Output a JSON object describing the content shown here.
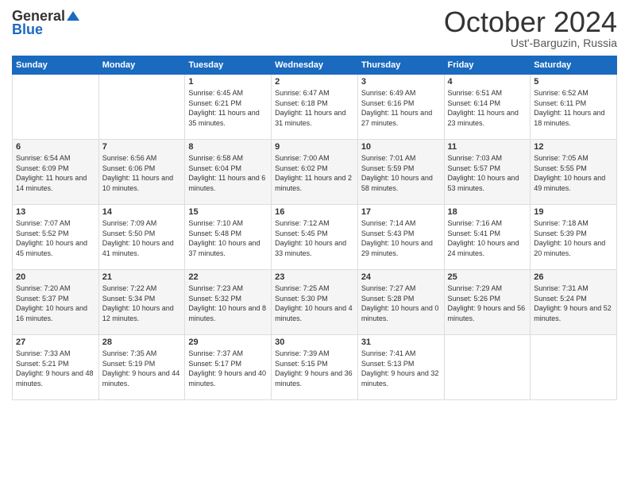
{
  "header": {
    "logo_general": "General",
    "logo_blue": "Blue",
    "month": "October 2024",
    "location": "Ust'-Barguzin, Russia"
  },
  "days_of_week": [
    "Sunday",
    "Monday",
    "Tuesday",
    "Wednesday",
    "Thursday",
    "Friday",
    "Saturday"
  ],
  "weeks": [
    [
      {
        "day": "",
        "info": ""
      },
      {
        "day": "",
        "info": ""
      },
      {
        "day": "1",
        "info": "Sunrise: 6:45 AM\nSunset: 6:21 PM\nDaylight: 11 hours and 35 minutes."
      },
      {
        "day": "2",
        "info": "Sunrise: 6:47 AM\nSunset: 6:18 PM\nDaylight: 11 hours and 31 minutes."
      },
      {
        "day": "3",
        "info": "Sunrise: 6:49 AM\nSunset: 6:16 PM\nDaylight: 11 hours and 27 minutes."
      },
      {
        "day": "4",
        "info": "Sunrise: 6:51 AM\nSunset: 6:14 PM\nDaylight: 11 hours and 23 minutes."
      },
      {
        "day": "5",
        "info": "Sunrise: 6:52 AM\nSunset: 6:11 PM\nDaylight: 11 hours and 18 minutes."
      }
    ],
    [
      {
        "day": "6",
        "info": "Sunrise: 6:54 AM\nSunset: 6:09 PM\nDaylight: 11 hours and 14 minutes."
      },
      {
        "day": "7",
        "info": "Sunrise: 6:56 AM\nSunset: 6:06 PM\nDaylight: 11 hours and 10 minutes."
      },
      {
        "day": "8",
        "info": "Sunrise: 6:58 AM\nSunset: 6:04 PM\nDaylight: 11 hours and 6 minutes."
      },
      {
        "day": "9",
        "info": "Sunrise: 7:00 AM\nSunset: 6:02 PM\nDaylight: 11 hours and 2 minutes."
      },
      {
        "day": "10",
        "info": "Sunrise: 7:01 AM\nSunset: 5:59 PM\nDaylight: 10 hours and 58 minutes."
      },
      {
        "day": "11",
        "info": "Sunrise: 7:03 AM\nSunset: 5:57 PM\nDaylight: 10 hours and 53 minutes."
      },
      {
        "day": "12",
        "info": "Sunrise: 7:05 AM\nSunset: 5:55 PM\nDaylight: 10 hours and 49 minutes."
      }
    ],
    [
      {
        "day": "13",
        "info": "Sunrise: 7:07 AM\nSunset: 5:52 PM\nDaylight: 10 hours and 45 minutes."
      },
      {
        "day": "14",
        "info": "Sunrise: 7:09 AM\nSunset: 5:50 PM\nDaylight: 10 hours and 41 minutes."
      },
      {
        "day": "15",
        "info": "Sunrise: 7:10 AM\nSunset: 5:48 PM\nDaylight: 10 hours and 37 minutes."
      },
      {
        "day": "16",
        "info": "Sunrise: 7:12 AM\nSunset: 5:45 PM\nDaylight: 10 hours and 33 minutes."
      },
      {
        "day": "17",
        "info": "Sunrise: 7:14 AM\nSunset: 5:43 PM\nDaylight: 10 hours and 29 minutes."
      },
      {
        "day": "18",
        "info": "Sunrise: 7:16 AM\nSunset: 5:41 PM\nDaylight: 10 hours and 24 minutes."
      },
      {
        "day": "19",
        "info": "Sunrise: 7:18 AM\nSunset: 5:39 PM\nDaylight: 10 hours and 20 minutes."
      }
    ],
    [
      {
        "day": "20",
        "info": "Sunrise: 7:20 AM\nSunset: 5:37 PM\nDaylight: 10 hours and 16 minutes."
      },
      {
        "day": "21",
        "info": "Sunrise: 7:22 AM\nSunset: 5:34 PM\nDaylight: 10 hours and 12 minutes."
      },
      {
        "day": "22",
        "info": "Sunrise: 7:23 AM\nSunset: 5:32 PM\nDaylight: 10 hours and 8 minutes."
      },
      {
        "day": "23",
        "info": "Sunrise: 7:25 AM\nSunset: 5:30 PM\nDaylight: 10 hours and 4 minutes."
      },
      {
        "day": "24",
        "info": "Sunrise: 7:27 AM\nSunset: 5:28 PM\nDaylight: 10 hours and 0 minutes."
      },
      {
        "day": "25",
        "info": "Sunrise: 7:29 AM\nSunset: 5:26 PM\nDaylight: 9 hours and 56 minutes."
      },
      {
        "day": "26",
        "info": "Sunrise: 7:31 AM\nSunset: 5:24 PM\nDaylight: 9 hours and 52 minutes."
      }
    ],
    [
      {
        "day": "27",
        "info": "Sunrise: 7:33 AM\nSunset: 5:21 PM\nDaylight: 9 hours and 48 minutes."
      },
      {
        "day": "28",
        "info": "Sunrise: 7:35 AM\nSunset: 5:19 PM\nDaylight: 9 hours and 44 minutes."
      },
      {
        "day": "29",
        "info": "Sunrise: 7:37 AM\nSunset: 5:17 PM\nDaylight: 9 hours and 40 minutes."
      },
      {
        "day": "30",
        "info": "Sunrise: 7:39 AM\nSunset: 5:15 PM\nDaylight: 9 hours and 36 minutes."
      },
      {
        "day": "31",
        "info": "Sunrise: 7:41 AM\nSunset: 5:13 PM\nDaylight: 9 hours and 32 minutes."
      },
      {
        "day": "",
        "info": ""
      },
      {
        "day": "",
        "info": ""
      }
    ]
  ]
}
